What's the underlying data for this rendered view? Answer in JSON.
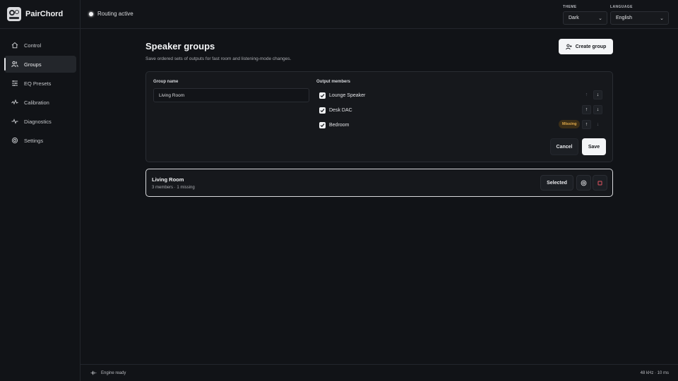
{
  "app": {
    "name": "PairChord"
  },
  "status": {
    "text": "Routing active"
  },
  "theme": {
    "label": "THEME",
    "value": "Dark"
  },
  "language": {
    "label": "LANGUAGE",
    "value": "English"
  },
  "nav": {
    "items": [
      {
        "label": "Control",
        "icon": "home-icon"
      },
      {
        "label": "Groups",
        "icon": "users-icon",
        "active": true
      },
      {
        "label": "EQ Presets",
        "icon": "sliders-icon"
      },
      {
        "label": "Calibration",
        "icon": "waveform-icon"
      },
      {
        "label": "Diagnostics",
        "icon": "pulse-icon"
      },
      {
        "label": "Settings",
        "icon": "gear-icon"
      }
    ]
  },
  "page": {
    "title": "Speaker groups",
    "subtitle": "Save ordered sets of outputs for fast room and listening-mode changes.",
    "create_button": "Create group"
  },
  "editor": {
    "group_name_label": "Group name",
    "group_name_value": "Living Room",
    "members_label": "Output members",
    "members": [
      {
        "name": "Lounge Speaker",
        "checked": true,
        "up": "↑",
        "down": "↓"
      },
      {
        "name": "Desk DAC",
        "checked": true,
        "up": "↑",
        "down": "↓"
      },
      {
        "name": "Bedroom",
        "checked": true,
        "badge": "Missing",
        "up": "↑",
        "down": "↓"
      }
    ],
    "cancel": "Cancel",
    "save": "Save"
  },
  "groups": [
    {
      "name": "Living Room",
      "meta": "3 members · 1 missing",
      "selected_label": "Selected"
    }
  ],
  "footer": {
    "engine": "Engine ready",
    "format": "48 kHz · 10 ms"
  },
  "colors": {
    "accent": "#f4f5f7",
    "missing": "#e0a94a",
    "delete": "#e05561"
  }
}
